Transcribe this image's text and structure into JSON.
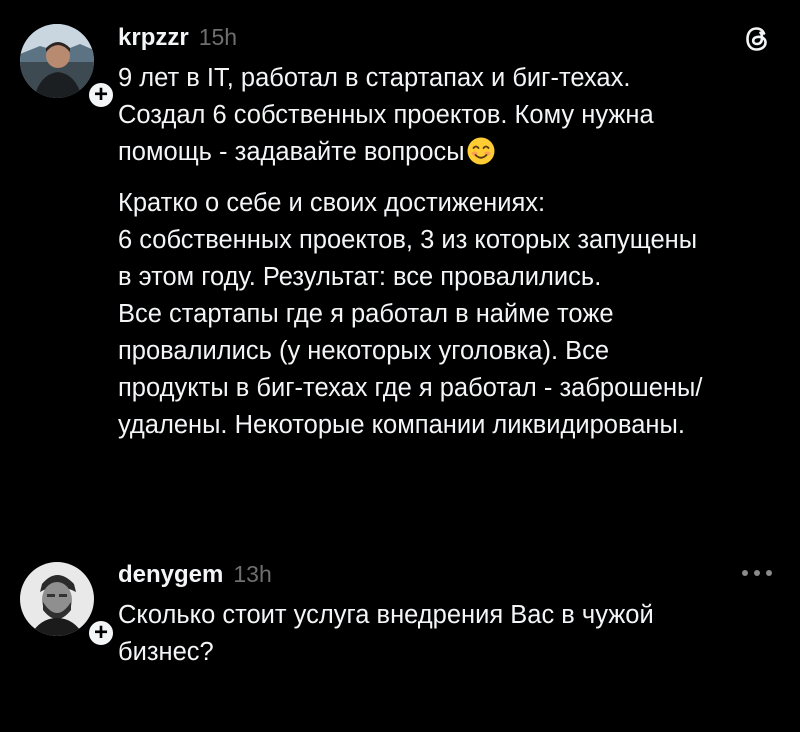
{
  "posts": [
    {
      "username": "krpzzr",
      "time": "15h",
      "lines": [
        {
          "text": "9 лет в IT, работал в стартапах и биг-техах."
        },
        {
          "text": "Создал 6 собственных проектов. Кому нужна"
        },
        {
          "text": "помощь - задавайте вопросы"
        },
        {
          "text": "Кратко о себе и своих достижениях:"
        },
        {
          "text": "6 собственных проектов, 3 из которых запущены"
        },
        {
          "text": "в этом году. Результат: все провалились."
        },
        {
          "text": "Все стартапы где я работал в найме тоже"
        },
        {
          "text": "провалились (у некоторых уголовка). Все"
        },
        {
          "text": "продукты в биг-техах где я работал - заброшены/"
        },
        {
          "text": "удалены. Некоторые компании ликвидированы."
        }
      ],
      "emoji": "smiling-face-icon"
    },
    {
      "username": "denygem",
      "time": "13h",
      "lines": [
        {
          "text": "Сколько стоит услуга внедрения Вас в чужой"
        },
        {
          "text": "бизнес?"
        }
      ]
    }
  ],
  "follow_symbol": "+",
  "icons": {
    "app": "threads-logo-icon",
    "more": "more-options-icon"
  },
  "colors": {
    "background": "#000000",
    "text": "#f3f5f7",
    "muted": "#6f6f6f"
  }
}
